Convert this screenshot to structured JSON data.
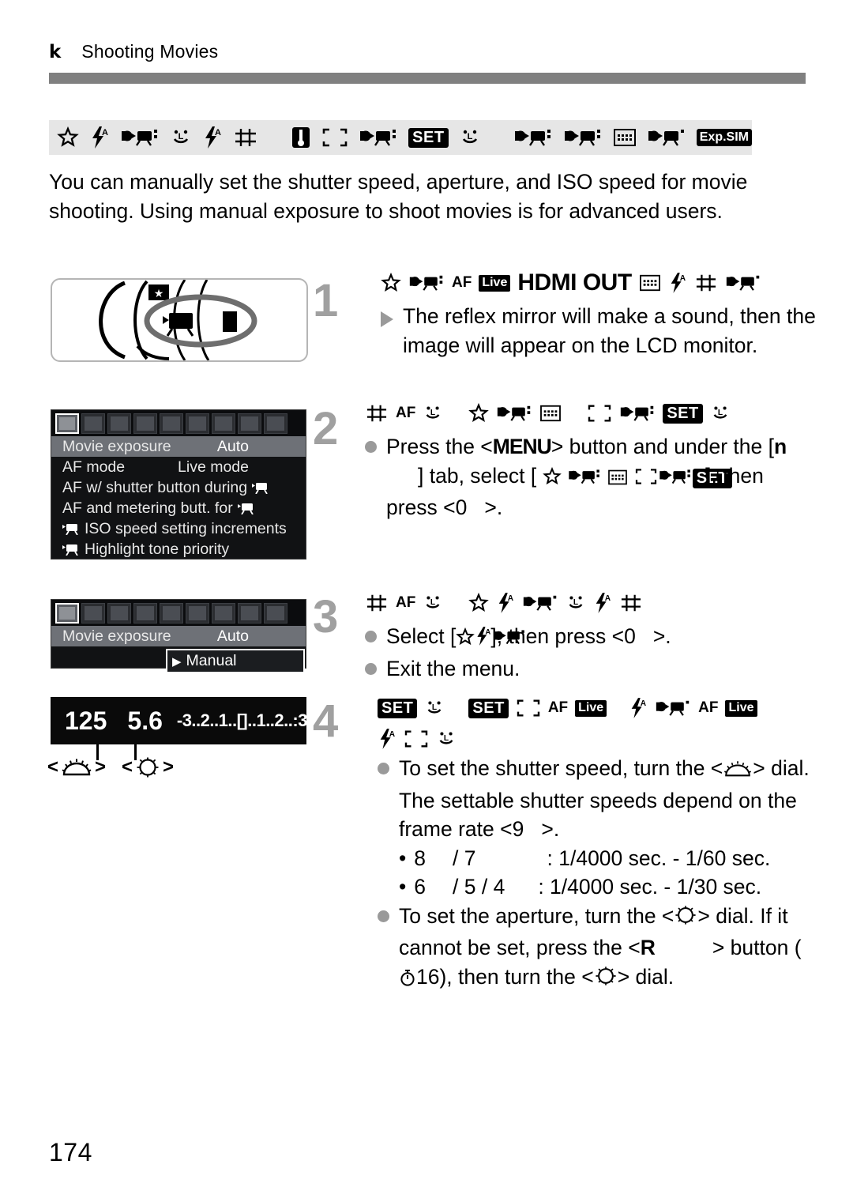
{
  "header": {
    "chapter_glyph": "k",
    "title": "Shooting Movies"
  },
  "intro": "You can manually set the shutter speed, aperture, and ISO speed for movie shooting. Using manual exposure to shoot movies is for advanced users.",
  "icon_strip": {
    "icons": [
      "star-icon",
      "flash-auto-icon",
      "movie-mode-icon",
      "smiley-icon",
      "flash-auto-icon",
      "grid-icon",
      "thermometer-icon",
      "brackets-icon",
      "movie-mode-icon",
      "set-badge",
      "smiley-icon",
      "movie-mode-icon",
      "movie-mode-icon",
      "grid-square-icon",
      "movie-mode-icon",
      "exp-sim-badge"
    ],
    "set_label": "SET",
    "exp_sim_label": "Exp.SIM"
  },
  "steps": [
    {
      "number": "1",
      "head_icons": [
        "star-icon",
        "movie-mode-icon",
        "af-live-badge",
        "hdmi-out-text",
        "grid-square-icon",
        "flash-auto-icon",
        "grid-icon",
        "movie-mode-icon"
      ],
      "af_label": "AF",
      "live_label": "Live",
      "hdmi_text": "HDMI OUT",
      "body": "The reflex mirror will make a sound, then the image will appear on the LCD monitor."
    },
    {
      "number": "2",
      "head_icons": [
        "grid-icon",
        "af-text",
        "smiley-icon",
        "star-icon",
        "movie-mode-icon",
        "grid-square-icon",
        "brackets-icon",
        "movie-mode-icon",
        "set-badge",
        "smiley-icon"
      ],
      "af_label": "AF",
      "set_label": "SET",
      "body_part1": "Press the <",
      "menu_label": "MENU",
      "body_part2": "> button and under",
      "body_line2_a": "the [",
      "tab_glyph": "n",
      "body_line2_b": "] tab, select [",
      "body_line3_a": "], then press <",
      "body_line3_b": "0",
      "body_line3_c": ">."
    },
    {
      "number": "3",
      "head_icons": [
        "grid-icon",
        "af-text",
        "smiley-icon",
        "star-icon",
        "flash-auto-icon",
        "movie-mode-icon",
        "smiley-icon",
        "flash-auto-icon",
        "grid-icon"
      ],
      "af_label": "AF",
      "select_a": "Select [",
      "select_b": "], then press <",
      "select_c": "0",
      "select_d": ">.",
      "exit": "Exit the menu."
    },
    {
      "number": "4",
      "head_icons": [
        "set-badge",
        "smiley-icon",
        "set-badge",
        "brackets-icon",
        "af-live-badge",
        "flash-auto-icon",
        "movie-mode-icon",
        "af-live-badge",
        "flash-auto-icon",
        "brackets-icon",
        "smiley-icon"
      ],
      "set_label": "SET",
      "af_label": "AF",
      "live_label": "Live",
      "bullet1_a": "To set the shutter speed, turn the <",
      "bullet1_b": "> dial. The settable shutter speeds depend on the frame rate <",
      "bullet1_c": "9",
      "bullet1_d": ">.",
      "rate_rows": [
        {
          "left": "8",
          "mid": "/ 7",
          "right": ": 1/4000 sec. - 1/60 sec."
        },
        {
          "left": "6",
          "mid": "/ 5    / 4",
          "right": ": 1/4000 sec. - 1/30 sec."
        }
      ],
      "bullet2_a": "To set the aperture, turn the <",
      "bullet2_b": "> dial. If it cannot be set, press the <",
      "bullet2_c": "R",
      "bullet2_d": "> button (",
      "bullet2_timer": "16",
      "bullet2_e": "), then turn the <",
      "bullet2_f": "> dial."
    }
  ],
  "lcd_menu_1": {
    "tab_count": 9,
    "selected_tab": 0,
    "rows": [
      {
        "label": "Movie exposure",
        "value": "Auto",
        "highlight": true
      },
      {
        "label": "AF mode",
        "value": "Live mode",
        "highlight": false
      },
      {
        "label": "AF w/ shutter button during",
        "value": "",
        "highlight": false,
        "trailing_icon": "movie-icon"
      },
      {
        "label": "AF and metering butt. for",
        "value": "",
        "highlight": false,
        "trailing_icon": "movie-icon"
      },
      {
        "label": "ISO speed setting increments",
        "value": "",
        "highlight": false,
        "leading_icon": "movie-icon"
      },
      {
        "label": "Highlight tone priority",
        "value": "",
        "highlight": false,
        "leading_icon": "movie-icon"
      }
    ]
  },
  "lcd_menu_2": {
    "tab_count": 9,
    "selected_tab": 0,
    "rows": [
      {
        "label": "Movie exposure",
        "value": "Auto",
        "highlight": true
      }
    ],
    "submenu_value": "Manual"
  },
  "exposure_display": {
    "shutter_speed": "125",
    "aperture": "5.6",
    "exposure_scale": "-3..2..1..[]..1..2..:3",
    "main_dial_label": "main-dial",
    "quick_dial_label": "quick-control-dial"
  },
  "page_number": "174",
  "colors": {
    "rule_gray": "#808080",
    "strip_bg": "#e6e6e6",
    "step_number_gray": "#a0a0a0",
    "lcd_bg": "#111214",
    "lcd_highlight": "#6e7177"
  }
}
